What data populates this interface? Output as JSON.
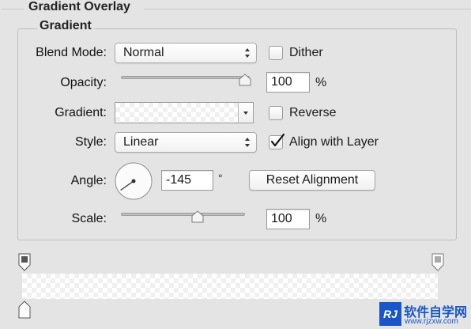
{
  "panel": {
    "section_title": "Gradient Overlay",
    "group_title": "Gradient"
  },
  "blend_mode": {
    "label": "Blend Mode:",
    "value": "Normal"
  },
  "dither": {
    "label": "Dither",
    "checked": false
  },
  "opacity": {
    "label": "Opacity:",
    "value": "100",
    "unit": "%",
    "level": 1.0
  },
  "gradient": {
    "label": "Gradient:"
  },
  "reverse": {
    "label": "Reverse",
    "checked": false
  },
  "style": {
    "label": "Style:",
    "value": "Linear"
  },
  "align_with_layer": {
    "label": "Align with Layer",
    "checked": true
  },
  "angle": {
    "label": "Angle:",
    "value": "-145",
    "unit": "°",
    "degrees": -145
  },
  "reset_alignment": {
    "label": "Reset Alignment"
  },
  "scale": {
    "label": "Scale:",
    "value": "100",
    "unit": "%",
    "level": 0.62
  },
  "gradient_editor": {
    "opacity_stop_left_color": "#555555",
    "opacity_stop_right_color": "#aaaaaa",
    "color_stop_color": "#ffffff"
  },
  "watermark": {
    "text": "软件自学网",
    "url": "www.rjzxw.com",
    "logo_text": "RJ"
  },
  "colors": {
    "background": "#e4e4e4",
    "watermark_blue": "#1a56c8"
  }
}
